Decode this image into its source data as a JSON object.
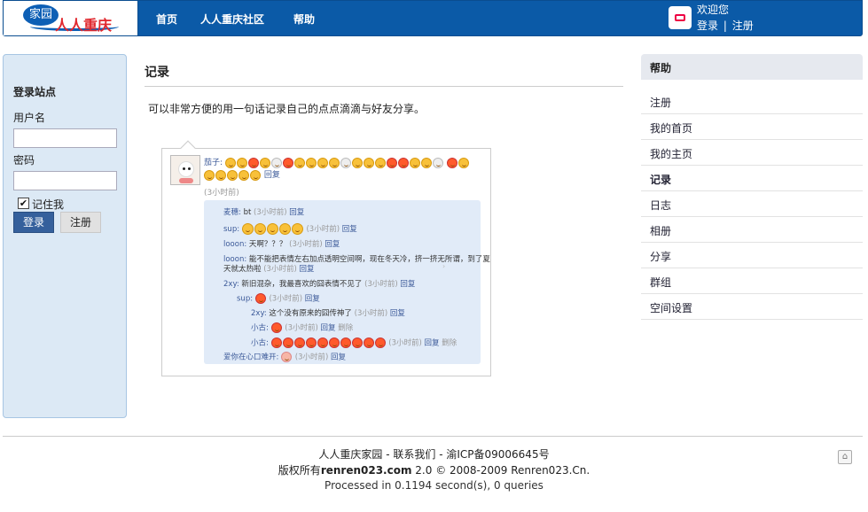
{
  "header": {
    "logo": {
      "oval_text": "家园",
      "brand_text": "人人重庆"
    },
    "nav": [
      "首页",
      "人人重庆社区",
      "帮助"
    ],
    "welcome": "欢迎您",
    "login_link": "登录",
    "separator": "|",
    "register_link": "注册"
  },
  "login": {
    "title": "登录站点",
    "username_label": "用户名",
    "username_value": "",
    "password_label": "密码",
    "password_value": "",
    "remember_label": "记住我",
    "remember_checked": true,
    "login_button": "登录",
    "register_button": "注册"
  },
  "main": {
    "title": "记录",
    "description": "可以非常方便的用一句话记录自己的点点滴滴与好友分享。"
  },
  "sample": {
    "author": "茄子:",
    "reply": "回复",
    "time": "(3小时前)",
    "comments": [
      {
        "name": "麦穗:",
        "text": "bt"
      },
      {
        "name": "sup:",
        "text": ""
      },
      {
        "name": "looon:",
        "text": "天啊？？？"
      },
      {
        "name": "looon:",
        "text": "能不能把表情左右加点透明空间啊，现在冬天冷，挤一挤无所谓，到了夏"
      },
      {
        "name": "",
        "text": "天就太热啦"
      },
      {
        "name": "2xy:",
        "text": "新旧混杂，我最喜欢的囧表情不见了"
      },
      {
        "name": "sup:",
        "text": ""
      },
      {
        "name": "2xy:",
        "text": "这个没有原来的囧传神了"
      },
      {
        "name": "小古:",
        "text": ""
      },
      {
        "name": "小古:",
        "text": ""
      },
      {
        "name": "爱你在心口难开:",
        "text": ""
      }
    ],
    "delete": "删除"
  },
  "help": {
    "title": "帮助",
    "items": [
      "注册",
      "我的首页",
      "我的主页",
      "记录",
      "日志",
      "相册",
      "分享",
      "群组",
      "空间设置"
    ],
    "active": "记录"
  },
  "footer": {
    "line1": "人人重庆家园 - 联系我们 - 渝ICP备09006645号",
    "line2_prefix": "版权所有",
    "line2_brand": "renren023.com",
    "line2_suffix": " 2.0 © 2008-2009 Renren023.Cn.",
    "line3": "Processed in 0.1194 second(s), 0 queries"
  }
}
